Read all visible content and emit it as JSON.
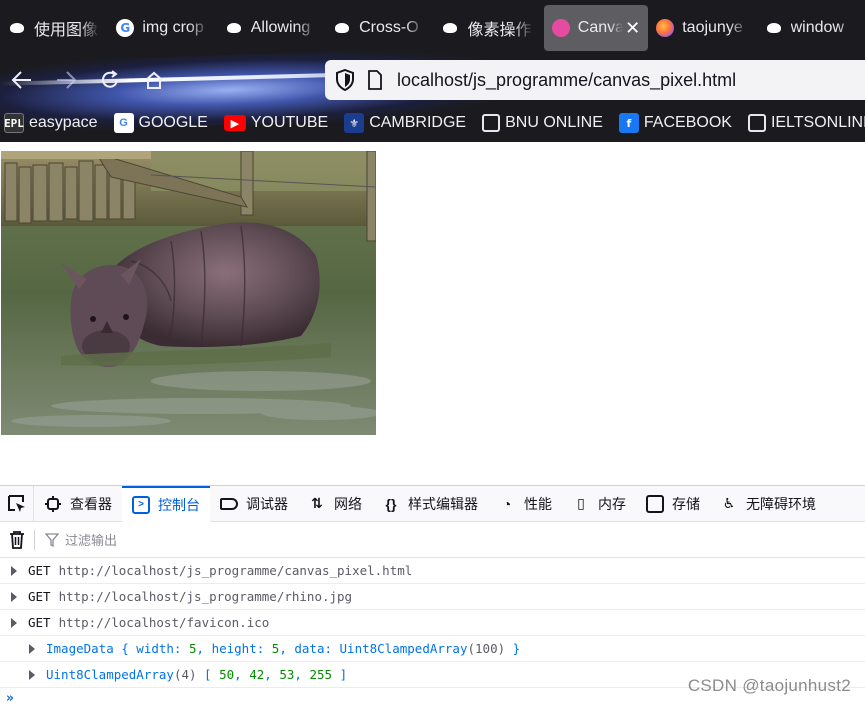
{
  "browser": {
    "tabs": [
      {
        "title": "使用图像",
        "icon": "paw-icon",
        "active": false
      },
      {
        "title": "img crop",
        "icon": "google-icon",
        "active": false
      },
      {
        "title": "Allowing",
        "icon": "paw-icon",
        "active": false
      },
      {
        "title": "Cross-O",
        "icon": "paw-icon",
        "active": false
      },
      {
        "title": "像素操作",
        "icon": "paw-icon",
        "active": false
      },
      {
        "title": "Canvas",
        "icon": "canvas-icon",
        "active": true
      },
      {
        "title": "taojunye",
        "icon": "firefox-icon",
        "active": false
      },
      {
        "title": "window",
        "icon": "paw-icon",
        "active": false
      }
    ],
    "url": "localhost/js_programme/canvas_pixel.html",
    "bookmarks": [
      {
        "label": "easypace",
        "icon": "epl-icon"
      },
      {
        "label": "GOOGLE",
        "icon": "google-icon"
      },
      {
        "label": "YOUTUBE",
        "icon": "youtube-icon"
      },
      {
        "label": "CAMBRIDGE",
        "icon": "cambridge-icon"
      },
      {
        "label": "BNU ONLINE",
        "icon": "globe-icon"
      },
      {
        "label": "FACEBOOK",
        "icon": "facebook-icon"
      },
      {
        "label": "IELTSONLINE",
        "icon": "globe-icon"
      }
    ]
  },
  "page": {
    "image_alt": "rhino.jpg"
  },
  "devtools": {
    "tabs": [
      {
        "label": "查看器",
        "icon": "inspector-icon"
      },
      {
        "label": "控制台",
        "icon": "console-icon",
        "active": true
      },
      {
        "label": "调试器",
        "icon": "debugger-icon"
      },
      {
        "label": "网络",
        "icon": "network-icon"
      },
      {
        "label": "样式编辑器",
        "icon": "style-editor-icon"
      },
      {
        "label": "性能",
        "icon": "performance-icon"
      },
      {
        "label": "内存",
        "icon": "memory-icon"
      },
      {
        "label": "存储",
        "icon": "storage-icon"
      },
      {
        "label": "无障碍环境",
        "icon": "accessibility-icon"
      }
    ],
    "filter_placeholder": "过滤输出",
    "logs": [
      {
        "method": "GET",
        "url": "http://localhost/js_programme/canvas_pixel.html"
      },
      {
        "method": "GET",
        "url": "http://localhost/js_programme/rhino.jpg"
      },
      {
        "method": "GET",
        "url": "http://localhost/favicon.ico"
      }
    ],
    "imagedata": {
      "prefix": "ImageData { width: ",
      "width": "5",
      "mid1": ", height: ",
      "height": "5",
      "mid2": ", data: Uint8ClampedArray",
      "len": "100",
      "suffix": " }"
    },
    "array": {
      "prefix": "Uint8ClampedArray",
      "count": "(4)",
      "open": " [ ",
      "v0": "50",
      "v1": "42",
      "v2": "53",
      "v3": "255",
      "sep": ", ",
      "close": " ]"
    },
    "prompt": "»"
  },
  "watermark": "CSDN @taojunhust2"
}
